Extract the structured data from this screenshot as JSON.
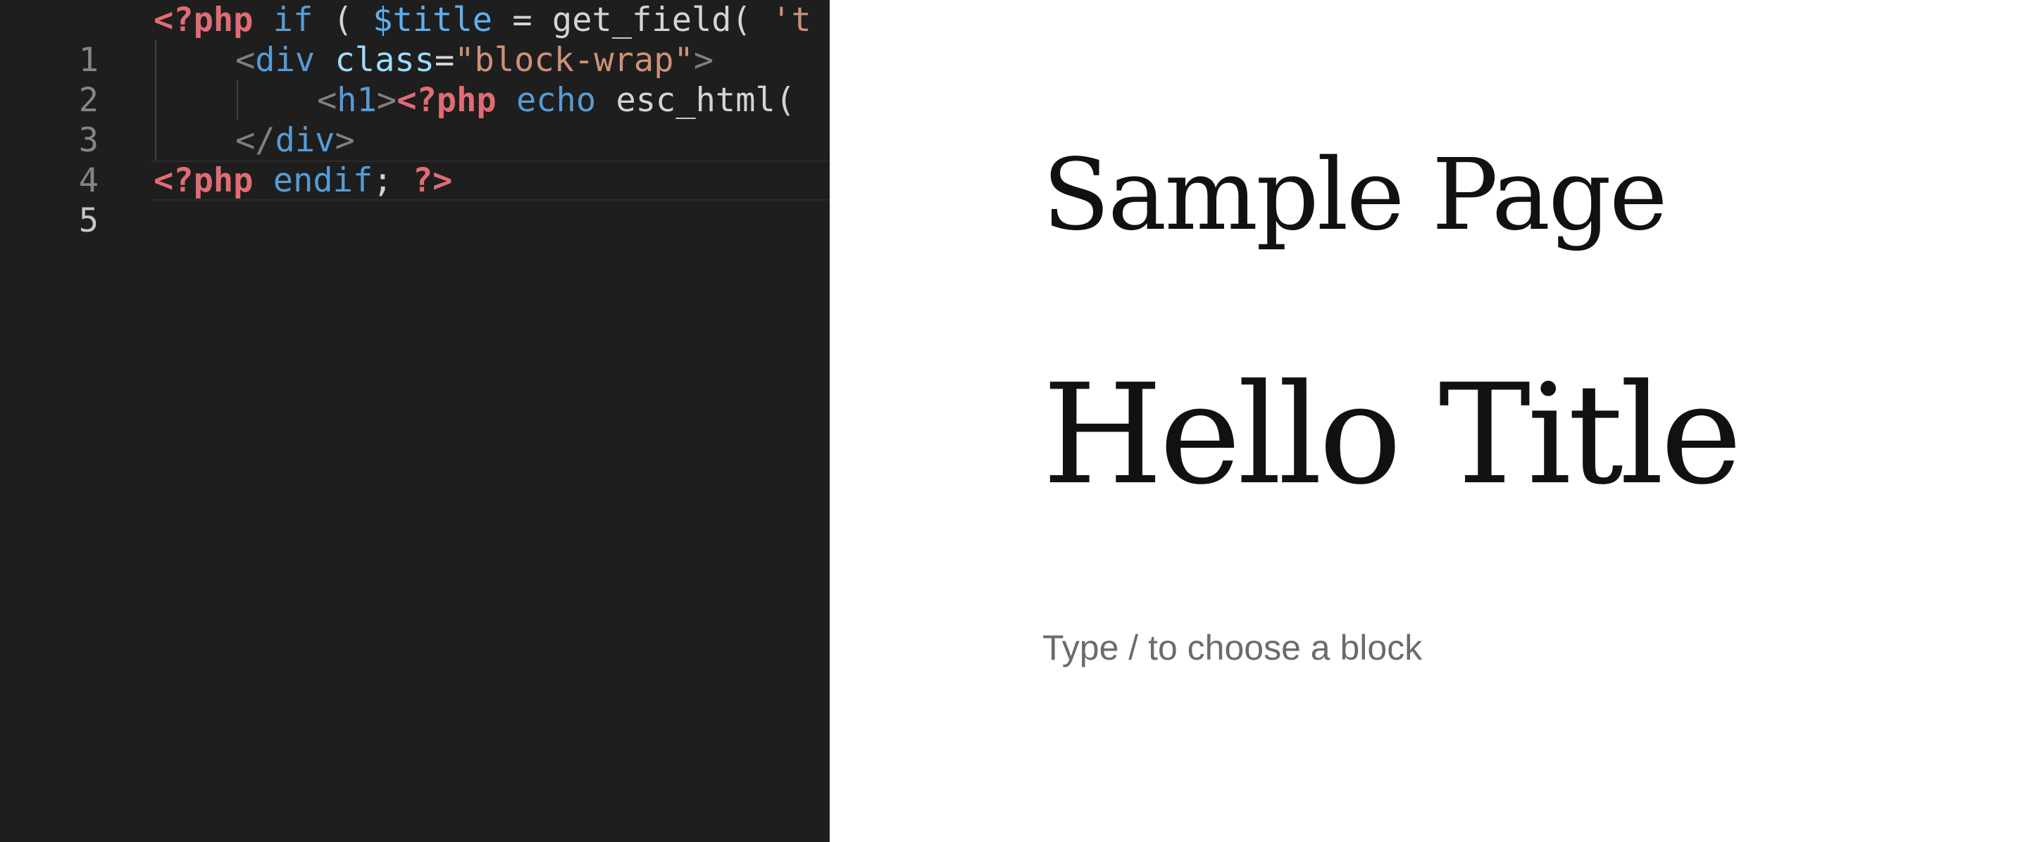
{
  "editor": {
    "lines": [
      {
        "number": "1",
        "tokens": [
          "<?php",
          " if",
          " ( ",
          "$title",
          " = get_field( ",
          "'t"
        ]
      },
      {
        "number": "2",
        "tokens": [
          "<",
          "div",
          " ",
          "class",
          "=",
          "\"block-wrap\"",
          ">"
        ]
      },
      {
        "number": "3",
        "tokens": [
          "<",
          "h1",
          ">",
          "<?php",
          " echo",
          " esc_html("
        ]
      },
      {
        "number": "4",
        "tokens": [
          "</",
          "div",
          ">"
        ]
      },
      {
        "number": "5",
        "tokens": [
          "<?php",
          " endif",
          "; ",
          "?>"
        ]
      }
    ],
    "active_line": "5"
  },
  "canvas": {
    "page_title": "Sample Page",
    "block_heading": "Hello Title",
    "block_placeholder": "Type / to choose a block"
  },
  "colors": {
    "editor_background": "#1e1e1e",
    "php_tag": "#e06c75",
    "keyword": "#569cd6",
    "string": "#ce9178",
    "canvas_background": "#ffffff",
    "placeholder_text": "#6b6b6b"
  }
}
